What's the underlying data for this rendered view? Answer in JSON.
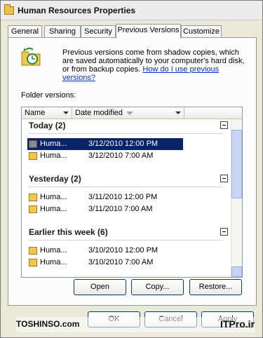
{
  "window": {
    "title": "Human Resources Properties",
    "icon": "folder-icon"
  },
  "tabs": [
    {
      "label": "General"
    },
    {
      "label": "Sharing"
    },
    {
      "label": "Security"
    },
    {
      "label": "Previous Versions"
    },
    {
      "label": "Customize"
    }
  ],
  "info": {
    "text": "Previous versions come from shadow copies, which are saved automatically to your computer's hard disk, or from backup copies. ",
    "link": "How do I use previous versions?"
  },
  "folder_versions_label": "Folder versions:",
  "columns": {
    "name": "Name",
    "date_modified": "Date modified"
  },
  "groups": [
    {
      "title": "Today (2)",
      "rows": [
        {
          "name": "Huma...",
          "date": "3/12/2010 12:00 PM",
          "selected": true
        },
        {
          "name": "Huma...",
          "date": "3/12/2010 7:00 AM"
        }
      ]
    },
    {
      "title": "Yesterday (2)",
      "rows": [
        {
          "name": "Huma...",
          "date": "3/11/2010 12:00 PM"
        },
        {
          "name": "Huma...",
          "date": "3/11/2010 7:00 AM"
        }
      ]
    },
    {
      "title": "Earlier this week (6)",
      "rows": [
        {
          "name": "Huma...",
          "date": "3/10/2010 12:00 PM"
        },
        {
          "name": "Huma...",
          "date": "3/10/2010 7:00 AM"
        }
      ]
    }
  ],
  "buttons": {
    "open": "Open",
    "copy": "Copy...",
    "restore": "Restore...",
    "ok": "OK",
    "cancel": "Cancel",
    "apply": "Apply"
  },
  "watermark": {
    "left": "TOSHINSO.com",
    "right": "ITPro.ir"
  }
}
